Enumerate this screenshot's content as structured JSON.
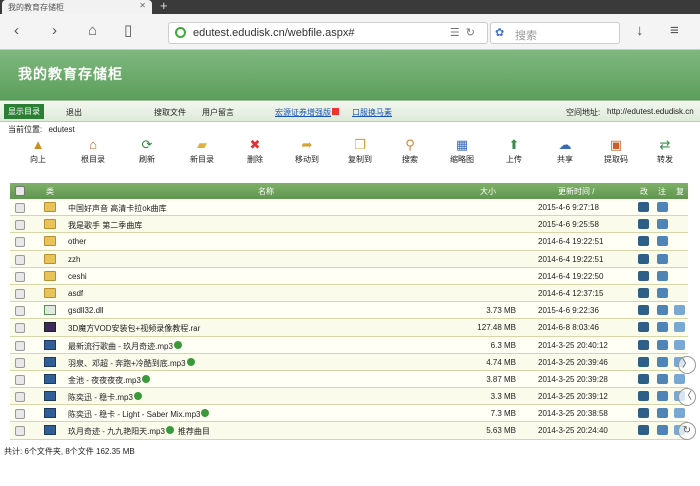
{
  "browser": {
    "tab_title": "我的教育存储柜",
    "url": "edutest.edudisk.cn/webfile.aspx#",
    "search_placeholder": "搜索"
  },
  "site": {
    "title": "我的教育存储柜",
    "menu": {
      "show_dir": "显示目录",
      "exit": "退出",
      "search_file": "搜取文件",
      "user_msg": "用户留言",
      "promo1": "宏源证券增强版",
      "promo2": "口服换马素",
      "space_label": "空间地址:",
      "space_url": "http://edutest.edudisk.cn"
    },
    "location_label": "当前位置:",
    "location_value": "edutest"
  },
  "toolbar": [
    "向上",
    "根目录",
    "刷新",
    "新目录",
    "删除",
    "移动到",
    "复制到",
    "搜索",
    "缩略图",
    "上传",
    "共享",
    "提取码",
    "转发"
  ],
  "table": {
    "headers": {
      "type": "类",
      "name": "名称",
      "size": "大小",
      "time": "更新时间 /",
      "c1": "改",
      "c2": "注",
      "c3": "复"
    },
    "rows": [
      {
        "kind": "folder",
        "name": "中国好声音 高清卡拉ok曲库",
        "size": "",
        "date": "2015-4-6 9:27:18",
        "copy": false
      },
      {
        "kind": "folder",
        "name": "我是歌手 第二季曲库",
        "size": "",
        "date": "2015-4-6 9:25:58",
        "copy": false
      },
      {
        "kind": "folder-open",
        "name": "other",
        "size": "",
        "date": "2014-6-4 19:22:51",
        "copy": false
      },
      {
        "kind": "folder",
        "name": "zzh",
        "size": "",
        "date": "2014-6-4 19:22:51",
        "copy": false
      },
      {
        "kind": "folder",
        "name": "ceshi",
        "size": "",
        "date": "2014-6-4 19:22:50",
        "copy": false
      },
      {
        "kind": "folder",
        "name": "asdf",
        "size": "",
        "date": "2014-6-4 12:37:15",
        "copy": false
      },
      {
        "kind": "dll",
        "name": "gsdll32.dll",
        "size": "3.73 MB",
        "date": "2015-4-6 9:22:36",
        "copy": true
      },
      {
        "kind": "rar",
        "name": "3D魔方VOD安装包+视频录像教程.rar",
        "size": "127.48 MB",
        "date": "2014-6-8 8:03:46",
        "copy": true
      },
      {
        "kind": "mp3",
        "name": "最新流行歌曲 - 玖月奇迹.mp3",
        "size": "6.3 MB",
        "date": "2014-3-25 20:40:12",
        "copy": true
      },
      {
        "kind": "mp3",
        "name": "羽泉、邓超 - 奔跑+冷酷到底.mp3",
        "size": "4.74 MB",
        "date": "2014-3-25 20:39:46",
        "copy": true
      },
      {
        "kind": "mp3",
        "name": "金池 - 夜夜夜夜.mp3",
        "size": "3.87 MB",
        "date": "2014-3-25 20:39:28",
        "copy": true
      },
      {
        "kind": "mp3",
        "name": "陈奕迅 - 稳卡.mp3",
        "size": "3.3 MB",
        "date": "2014-3-25 20:39:12",
        "copy": true
      },
      {
        "kind": "mp3",
        "name": "陈奕迅 - 稳卡 - Light - Saber Mix.mp3",
        "size": "7.3 MB",
        "date": "2014-3-25 20:38:58",
        "copy": true
      },
      {
        "kind": "mp3",
        "name": "玖月奇迹 - 九九艳阳天.mp3",
        "size": "5.63 MB",
        "date": "2014-3-25 20:24:40",
        "copy": true,
        "extra": "推荐曲目"
      }
    ]
  },
  "footer": "共计: 6个文件夹, 8个文件 162.35 MB"
}
